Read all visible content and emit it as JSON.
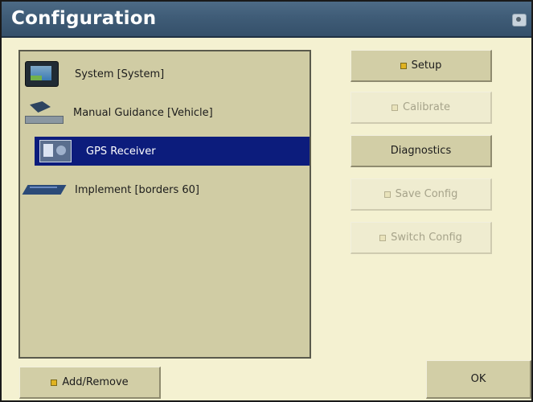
{
  "window": {
    "title": "Configuration",
    "camera_icon": "camera-icon"
  },
  "tree": {
    "items": [
      {
        "label": "System [System]",
        "icon": "display-icon",
        "selected": false
      },
      {
        "label": "Manual Guidance [Vehicle]",
        "icon": "tractor-icon",
        "selected": false
      },
      {
        "label": "GPS Receiver",
        "icon": "gps-receiver-icon",
        "selected": true
      },
      {
        "label": "Implement [borders 60]",
        "icon": "implement-icon",
        "selected": false
      }
    ]
  },
  "buttons": {
    "setup": {
      "label": "Setup",
      "enabled": true
    },
    "calibrate": {
      "label": "Calibrate",
      "enabled": false
    },
    "diagnostics": {
      "label": "Diagnostics",
      "enabled": true
    },
    "save_config": {
      "label": "Save Config",
      "enabled": false
    },
    "switch_config": {
      "label": "Switch Config",
      "enabled": false
    },
    "add_remove": {
      "label": "Add/Remove",
      "enabled": true
    },
    "ok": {
      "label": "OK",
      "enabled": true
    }
  },
  "colors": {
    "titlebar": "#3f5c77",
    "background": "#f4f1d1",
    "panel": "#d0cca4",
    "selection": "#0c1c7c"
  }
}
